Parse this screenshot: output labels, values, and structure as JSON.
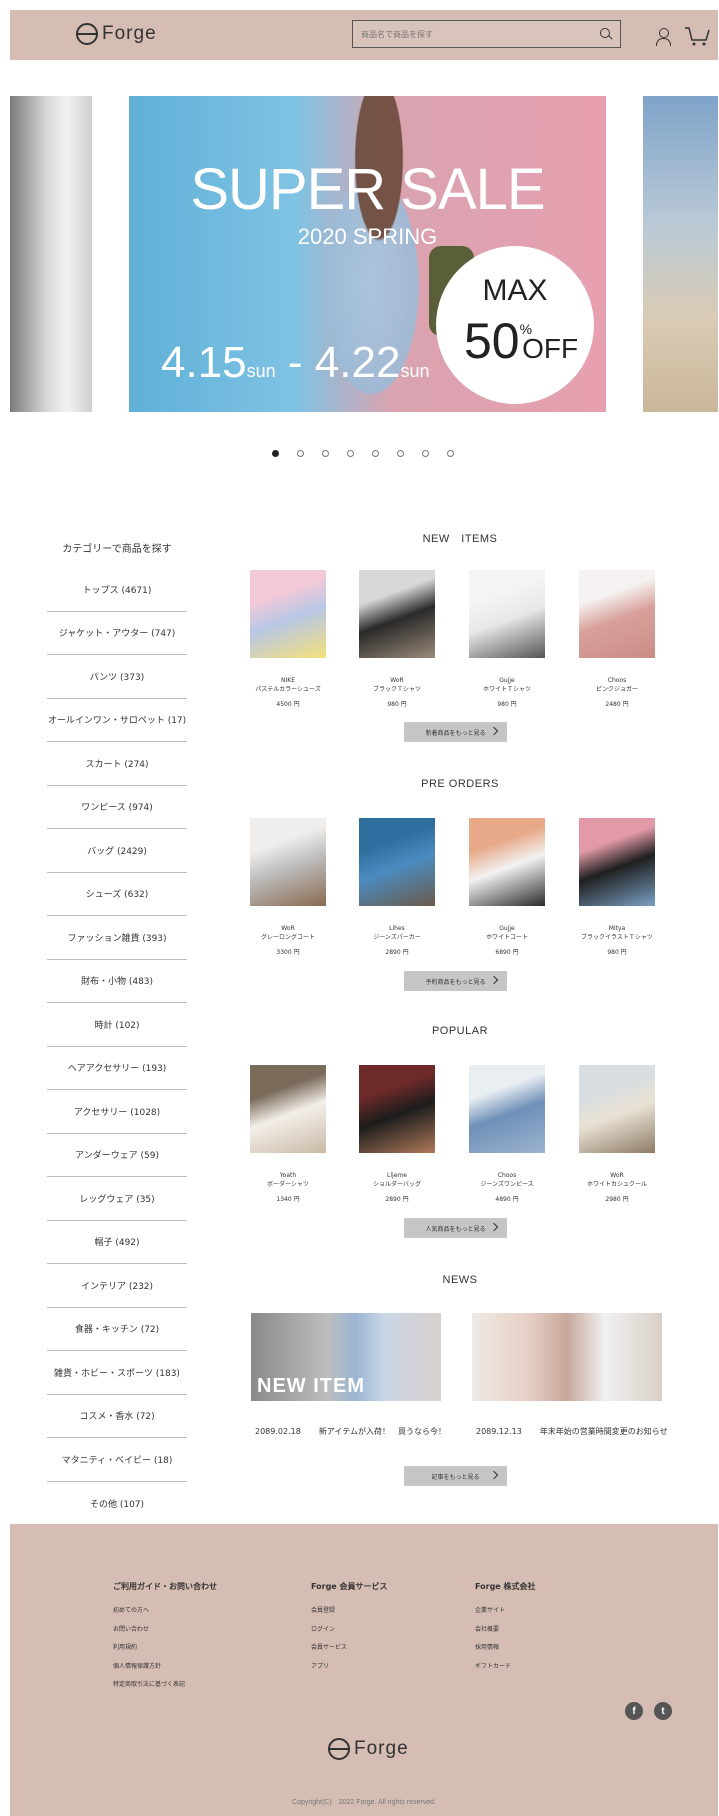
{
  "header": {
    "logo_text": "Forge",
    "search_placeholder": "商品名で商品を探す"
  },
  "hero": {
    "title": "SUPER SALE",
    "subtitle": "2020 SPRING",
    "date_start": "4.15",
    "date_end": "4.22",
    "day_label": "sun",
    "dash": "-",
    "badge_max": "MAX",
    "badge_value": "50",
    "badge_percent": "%",
    "badge_off": "OFF"
  },
  "carousel": {
    "total_slides": 8,
    "active_index": 0
  },
  "categories": {
    "title": "カテゴリーで商品を探す",
    "items": [
      "トップス (4671)",
      "ジャケット・アウター (747)",
      "パンツ (373)",
      "オールインワン・サロペット (17)",
      "スカート (274)",
      "ワンピース (974)",
      "バッグ (2429)",
      "シューズ (632)",
      "ファッション雑貨 (393)",
      "財布・小物 (483)",
      "時計 (102)",
      "ヘアアクセサリー (193)",
      "アクセサリー (1028)",
      "アンダーウェア (59)",
      "レッグウェア (35)",
      "帽子 (492)",
      "インテリア (232)",
      "食器・キッチン (72)",
      "雑貨・ホビー・スポーツ (183)",
      "コスメ・香水 (72)",
      "マタニティ・ベイビー (18)",
      "その他 (107)"
    ]
  },
  "new_items": {
    "title": "NEW　ITEMS",
    "more_label": "新着商品をもっと見る",
    "products": [
      {
        "brand": "NIKE",
        "name": "パステルカラーシューズ",
        "price": "4500 円",
        "colors": [
          "#f3c9d8",
          "#b8c7e6",
          "#f4e07a"
        ]
      },
      {
        "brand": "WoR",
        "name": "ブラックＴシャツ",
        "price": "980 円",
        "colors": [
          "#d8d8d8",
          "#2a2a2a",
          "#9a8a7a"
        ]
      },
      {
        "brand": "Gujje",
        "name": "ホワイトＴシャツ",
        "price": "980 円",
        "colors": [
          "#f4f4f4",
          "#e8e8e8",
          "#555555"
        ]
      },
      {
        "brand": "Choos",
        "name": "ピンクジョガー",
        "price": "2480 円",
        "colors": [
          "#f5f2f1",
          "#d9a09a",
          "#c98d86"
        ]
      }
    ]
  },
  "pre_orders": {
    "title": "PRE ORDERS",
    "more_label": "予約商品をもっと見る",
    "products": [
      {
        "brand": "WoR",
        "name": "グレーロングコート",
        "price": "3300 円",
        "colors": [
          "#f0eeec",
          "#bdbdbd",
          "#8a6a50"
        ]
      },
      {
        "brand": "Lihes",
        "name": "ジーンズパーカー",
        "price": "2890 円",
        "colors": [
          "#2f6fa0",
          "#4b8bbf",
          "#6a5a4a"
        ]
      },
      {
        "brand": "Gujje",
        "name": "ホワイトコート",
        "price": "6890 円",
        "colors": [
          "#e8a988",
          "#f2f2f2",
          "#2a2a2a"
        ]
      },
      {
        "brand": "Mitya",
        "name": "ブラックイラストＴシャツ",
        "price": "980 円",
        "colors": [
          "#e39aa8",
          "#1f1f1f",
          "#7aa0c4"
        ]
      }
    ]
  },
  "popular": {
    "title": "POPULAR",
    "more_label": "人気商品をもっと見る",
    "products": [
      {
        "brand": "Yoath",
        "name": "ボーダーシャツ",
        "price": "1340 円",
        "extra": "",
        "colors": [
          "#7a6a5a",
          "#f3efe9",
          "#c9b9a5"
        ]
      },
      {
        "brand": "Lljeme",
        "name": "ショルダーバッグ",
        "price": "2890 円",
        "extra": "",
        "colors": [
          "#6e2a28",
          "#1c1c1c",
          "#b07a5a"
        ]
      },
      {
        "brand": "Choos",
        "name": "ジーンズワンピース",
        "price": "4890 円",
        "extra": "",
        "colors": [
          "#e9eef3",
          "#6f90b8",
          "#9db3cf"
        ]
      },
      {
        "brand": "WoR",
        "name": "ホワイトカシュクール",
        "price": "2980 円",
        "extra": "",
        "colors": [
          "#d8dde2",
          "#e9e2d4",
          "#8e7a66"
        ]
      }
    ]
  },
  "news": {
    "title": "NEWS",
    "more_label": "記事をもっと見る",
    "items": [
      {
        "date": "2089.02.18",
        "text": "新アイテムが入荷！　買うなら今！",
        "overlay": "NEW ITEM"
      },
      {
        "date": "2089.12.13",
        "text": "年末年始の営業時間変更のお知らせ",
        "overlay": ""
      }
    ]
  },
  "footer": {
    "columns": [
      {
        "title": "ご利用ガイド・お問い合わせ",
        "links": [
          "初めての方へ",
          "お問い合わせ",
          "利用規約",
          "個人情報保護方針",
          "特定商取引法に基づく表記"
        ]
      },
      {
        "title": "Forge 会員サービス",
        "links": [
          "会員登録",
          "ログイン",
          "会員サービス",
          "アプリ"
        ]
      },
      {
        "title": "Forge 株式会社",
        "links": [
          "企業サイト",
          "会社概要",
          "採用情報",
          "ギフトカード"
        ]
      }
    ],
    "social": [
      {
        "icon": "facebook-icon",
        "glyph": "f"
      },
      {
        "icon": "twitter-icon",
        "glyph": "t"
      }
    ],
    "logo_text": "Forge",
    "copyright": "Copyright(C)　2022  Forge. All rights reserved."
  }
}
